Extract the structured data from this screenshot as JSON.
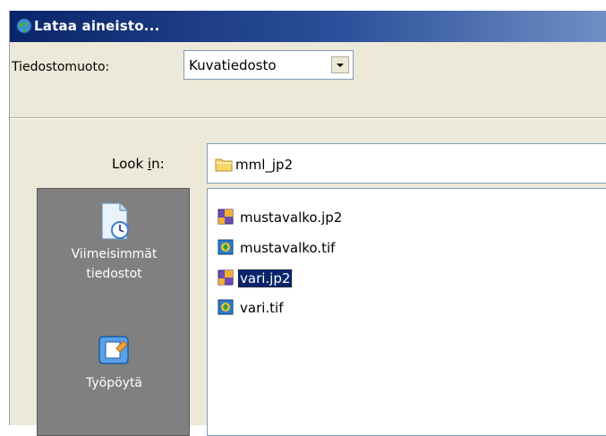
{
  "window": {
    "title": "Lataa aineisto..."
  },
  "file_type": {
    "label": "Tiedostomuoto:",
    "selected": "Kuvatiedosto"
  },
  "look_in": {
    "label_prefix": "Look ",
    "label_accel": "i",
    "label_suffix": "n:",
    "folder": "mml_jp2"
  },
  "places": [
    {
      "label_line1": "Viimeisimmät",
      "label_line2": "tiedostot",
      "icon": "recent-documents-icon"
    },
    {
      "label_line1": "Työpöytä",
      "label_line2": "",
      "icon": "desktop-icon"
    }
  ],
  "files": [
    {
      "name": "mustavalko.jp2",
      "icon": "jp2-file-icon",
      "selected": false
    },
    {
      "name": "mustavalko.tif",
      "icon": "tif-file-icon",
      "selected": false
    },
    {
      "name": "vari.jp2",
      "icon": "jp2-file-icon",
      "selected": true
    },
    {
      "name": "vari.tif",
      "icon": "tif-file-icon",
      "selected": false
    }
  ]
}
